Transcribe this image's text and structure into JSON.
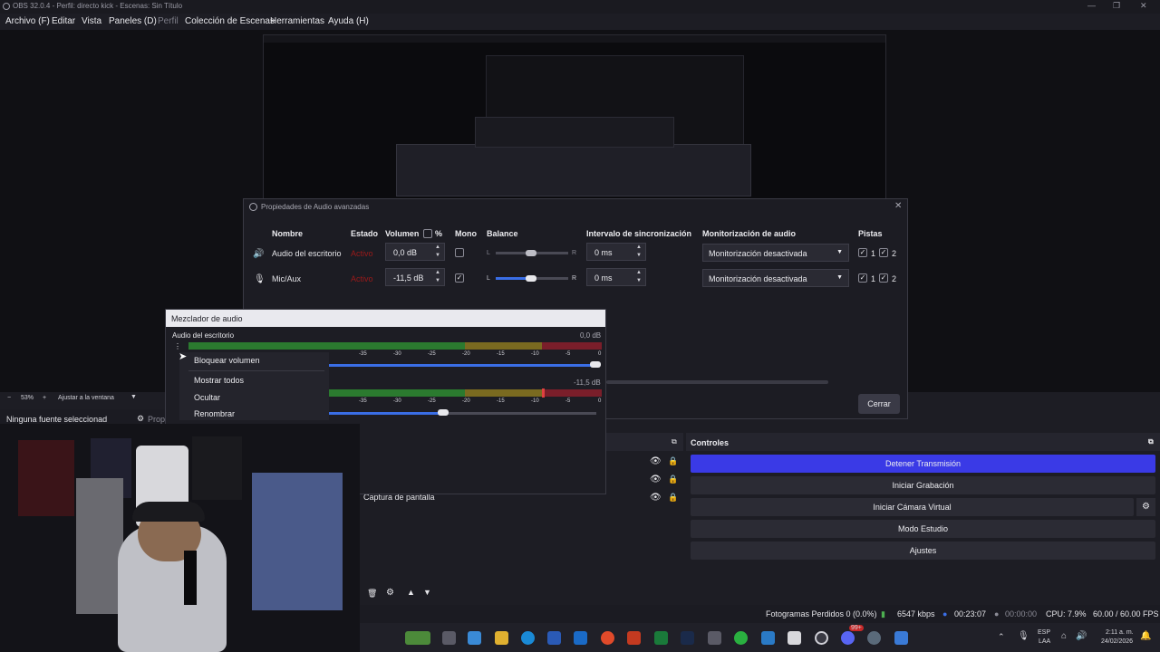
{
  "window": {
    "title": "OBS 32.0.4 - Perfil: directo kick - Escenas: Sin Título",
    "controls": [
      "—",
      "❐",
      "✕"
    ]
  },
  "menu": {
    "items": [
      "Archivo (F)",
      "Editar",
      "Vista",
      "Paneles (D)",
      "Perfil",
      "Colección de Escenas",
      "Herramientas",
      "Ayuda (H)"
    ]
  },
  "advanced_audio": {
    "title": "Propiedades de Audio avanzadas",
    "headers": {
      "name": "Nombre",
      "status": "Estado",
      "volume": "Volumen",
      "percent": "%",
      "mono": "Mono",
      "balance": "Balance",
      "sync": "Intervalo de sincronización",
      "monitoring": "Monitorización de audio",
      "tracks": "Pistas"
    },
    "rows": [
      {
        "name": "Audio del escritorio",
        "status": "Activo",
        "volume": "0,0 dB",
        "mono": false,
        "balance_l": "L",
        "balance_r": "R",
        "balance_position": 0.5,
        "sync": "0 ms",
        "monitoring": "Monitorización desactivada",
        "track1": "1",
        "track2": "2"
      },
      {
        "name": "Mic/Aux",
        "status": "Activo",
        "volume": "-11,5 dB",
        "mono": true,
        "balance_l": "L",
        "balance_r": "R",
        "balance_position": 0.5,
        "sync": "0 ms",
        "monitoring": "Monitorización desactivada",
        "track1": "1",
        "track2": "2"
      }
    ],
    "close_label": "Cerrar"
  },
  "mixer": {
    "title": "Mezclador de audio",
    "channels": [
      {
        "name": "Audio del escritorio",
        "db": "0,0 dB",
        "fader_fraction": 1.0
      },
      {
        "name": "",
        "db": "-11,5 dB",
        "fader_fraction": 0.45
      }
    ],
    "scale": [
      "-35",
      "-30",
      "-25",
      "-20",
      "-15",
      "-10",
      "-5",
      "0"
    ],
    "scale_left": [
      "-35",
      "-30",
      "-25",
      "-20",
      "-15",
      "-10",
      "-5",
      "0"
    ]
  },
  "context_menu": {
    "items": [
      "Bloquear volumen",
      "Mostrar todos",
      "Ocultar",
      "Renombrar"
    ]
  },
  "preview_bar": {
    "zoom": "53%",
    "fit": "Ajustar a la ventana",
    "no_source": "Ninguna fuente seleccionad",
    "props": "Prop"
  },
  "sources": {
    "visible_item": "Captura de pantalla"
  },
  "controls": {
    "title": "Controles",
    "buttons": [
      "Detener Transmisión",
      "Iniciar Grabación",
      "Iniciar Cámara Virtual",
      "Modo Estudio",
      "Ajustes"
    ]
  },
  "status": {
    "dropped": "Fotogramas Perdidos 0 (0.0%)",
    "bitrate": "6547 kbps",
    "stream_time": "00:23:07",
    "rec_time": "00:00:00",
    "cpu": "CPU: 7.9%",
    "fps": "60.00 / 60.00 FPS"
  },
  "taskbar": {
    "lang": "ESP",
    "layout": "LAA",
    "time": "2:11 a. m.",
    "date": "24/02/2026",
    "badge": "99+"
  },
  "colors": {
    "accent": "#3a3ae6",
    "active_red": "#9c1a1a"
  }
}
